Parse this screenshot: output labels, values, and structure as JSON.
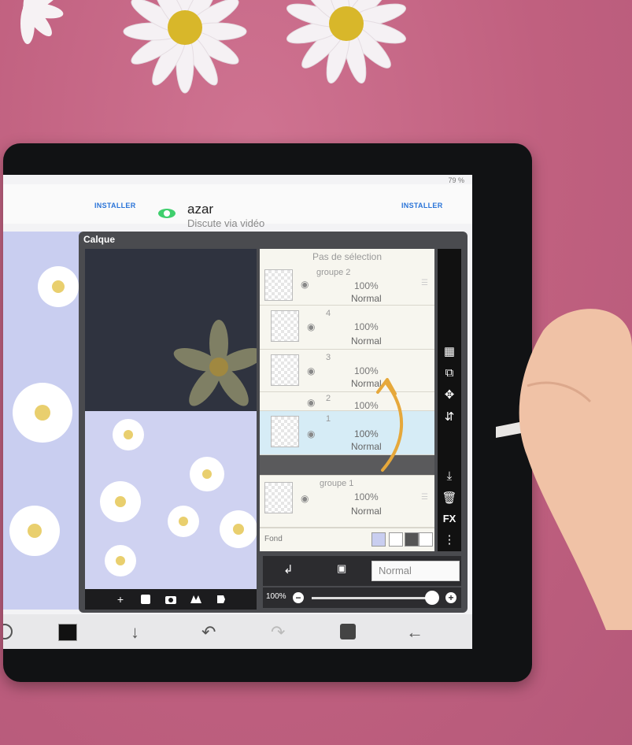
{
  "status_bar": {
    "battery": "79 %"
  },
  "ad": {
    "install_left": "INSTALLER",
    "install_right": "INSTALLER",
    "app_name": "azar",
    "tagline": "Discute via vidéo"
  },
  "layer_panel": {
    "title": "Calque",
    "no_selection": "Pas de sélection",
    "layers": [
      {
        "name": "groupe 2",
        "opacity": "100%",
        "mode": "Normal",
        "selected": false
      },
      {
        "name": "4",
        "opacity": "100%",
        "mode": "Normal",
        "selected": false
      },
      {
        "name": "3",
        "opacity": "100%",
        "mode": "Normal",
        "selected": false
      },
      {
        "name": "2",
        "opacity": "100%",
        "mode": "",
        "selected": false
      },
      {
        "name": "1",
        "opacity": "100%",
        "mode": "Normal",
        "selected": true
      },
      {
        "name": "groupe 1",
        "opacity": "100%",
        "mode": "Normal",
        "selected": false
      }
    ],
    "background_label": "Fond",
    "blend_mode": "Normal",
    "opacity_label": "100%",
    "opacity_value": 1.0,
    "side_tools": [
      "checker-icon",
      "merge-icon",
      "move-icon",
      "flip-icon",
      "download-icon",
      "trash-icon",
      "FX",
      "more-icon"
    ],
    "fx_label": "FX"
  },
  "preview_tools": {
    "add": "+",
    "icons": [
      "add-layer-icon",
      "camera-icon",
      "folder-icon",
      "export-icon"
    ]
  },
  "bottom_toolbar": {
    "icons": [
      "color-swatch",
      "down-arrow-icon",
      "undo-icon",
      "redo-icon",
      "layers-icon",
      "back-icon"
    ]
  },
  "colors": {
    "background": "#c46585",
    "artwork_lavender": "#c9cef0",
    "artwork_navy": "#2f333f",
    "selected_layer": "#d6ecf6",
    "arrow": "#e6a83b"
  }
}
